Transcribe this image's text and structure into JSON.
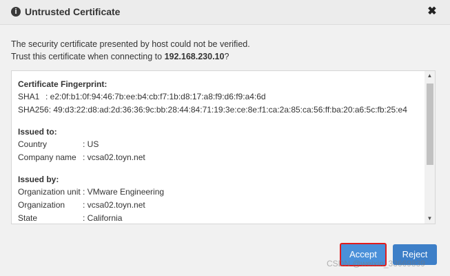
{
  "header": {
    "title": "Untrusted Certificate",
    "info_icon_glyph": "i",
    "close_icon_glyph": "✖"
  },
  "intro": {
    "line1": "The security certificate presented by host could not be verified.",
    "line2_prefix": "Trust this certificate when connecting to ",
    "host": "192.168.230.10",
    "line2_suffix": "?"
  },
  "certificate": {
    "fingerprint": {
      "title": "Certificate Fingerprint:",
      "rows": [
        {
          "label": "SHA1",
          "sep": ": ",
          "value": "e2:0f:b1:0f:94:46:7b:ee:b4:cb:f7:1b:d8:17:a8:f9:d6:f9:a4:6d"
        },
        {
          "label": "SHA256",
          "sep": ": ",
          "value": "49:d3:22:d8:ad:2d:36:36:9c:bb:28:44:84:71:19:3e:ce:8e:f1:ca:2a:85:ca:56:ff:ba:20:a6:5c:fb:25:e4"
        }
      ]
    },
    "issued_to": {
      "title": "Issued to:",
      "rows": [
        {
          "label": "Country",
          "sep": ": ",
          "value": "US"
        },
        {
          "label": "Company name",
          "sep": ": ",
          "value": "vcsa02.toyn.net"
        }
      ]
    },
    "issued_by": {
      "title": "Issued by:",
      "rows": [
        {
          "label": "Organization unit",
          "sep": ": ",
          "value": "VMware Engineering"
        },
        {
          "label": "Organization",
          "sep": ": ",
          "value": "vcsa02.toyn.net"
        },
        {
          "label": "State",
          "sep": ": ",
          "value": "California"
        }
      ]
    }
  },
  "scrollbar": {
    "up_glyph": "▲",
    "down_glyph": "▼"
  },
  "buttons": {
    "accept": "Accept",
    "reject": "Reject"
  },
  "watermark": "CSDN @weixin_33669839",
  "colors": {
    "accent": "#4a90d9",
    "highlight_border": "#e21b1b"
  }
}
